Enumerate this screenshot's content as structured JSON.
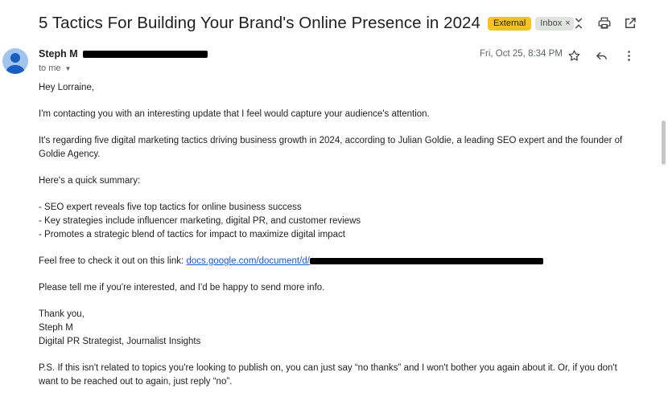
{
  "email": {
    "subject": "5 Tactics For Building Your Brand's Online Presence in 2024",
    "labels": {
      "external": "External",
      "inbox": "Inbox",
      "inbox_remove": "×"
    },
    "sender_name": "Steph M",
    "recipient_line": "to me",
    "date": "Fri, Oct 25, 8:34 PM",
    "body": {
      "greeting": "Hey Lorraine,",
      "p1": "I'm contacting you with an interesting update that I feel would capture your audience's attention.",
      "p2": "It's regarding five digital marketing tactics driving business growth in 2024, according to Julian Goldie, a leading SEO expert and the founder of Goldie Agency.",
      "p3": "Here's a quick summary:",
      "bullets": [
        "- SEO expert reveals five top tactics for online business success",
        "- Key strategies include influencer marketing, digital PR, and customer reviews",
        "- Promotes a strategic blend of tactics for impact to maximize digital impact"
      ],
      "link_intro": "Feel free to check it out on this link: ",
      "link_text": "docs.google.com/document/d/",
      "p5": "Please tell me if you're interested, and I'd be happy to send more info.",
      "signoff": "Thank you,",
      "sig_name": "Steph M",
      "sig_title": "Digital PR Strategist, Journalist Insights",
      "ps": "P.S. If this isn't related to topics you're looking to publish on, you can just say “no thanks” and I won't bother you again about it. Or, if you don't want to be reached out to again, just reply “no”."
    }
  },
  "icons": {
    "expand": "unfold-icon",
    "print": "print-icon",
    "open_new": "open-in-new-window-icon",
    "star": "star-icon",
    "reply": "reply-icon",
    "more": "more-vert-icon",
    "avatar": "person-avatar-icon"
  },
  "colors": {
    "external_badge": "#f6c026",
    "link": "#1a56c8",
    "avatar_bg": "#a0c3f0"
  }
}
